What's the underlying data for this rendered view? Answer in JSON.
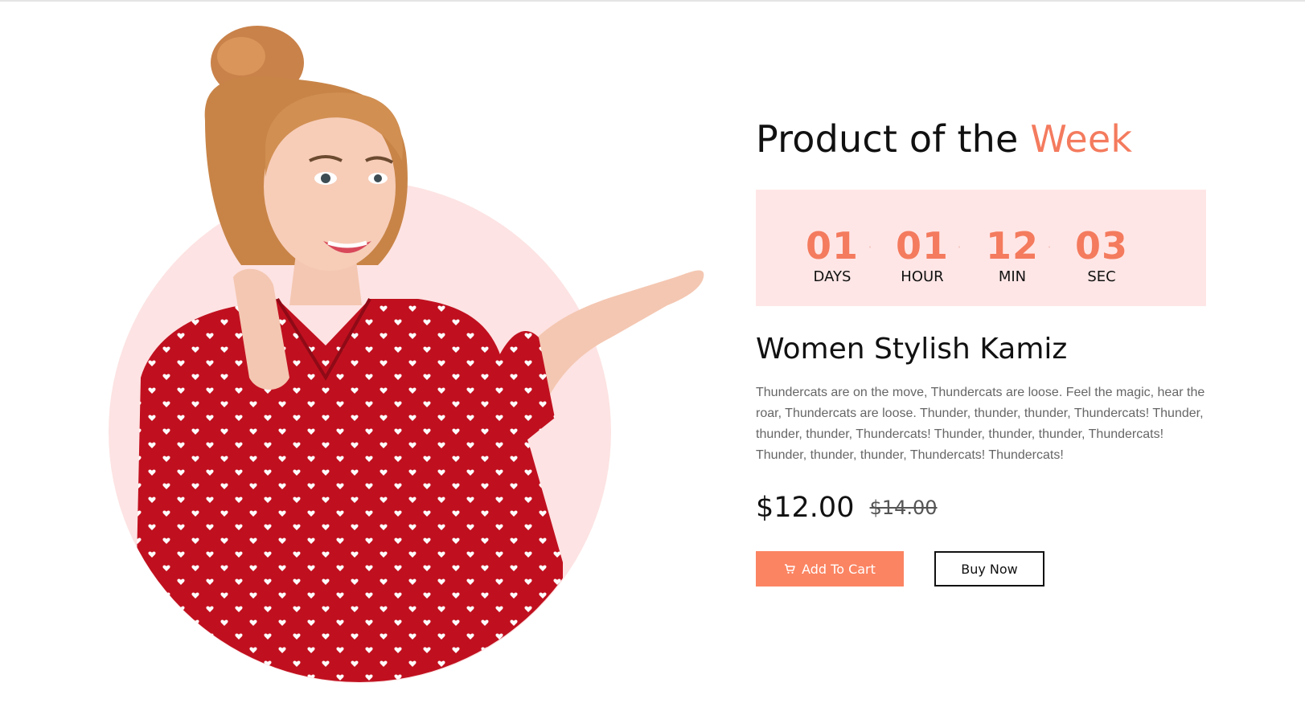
{
  "section": {
    "heading_main": "Product of the",
    "heading_accent": "Week"
  },
  "countdown": {
    "units": [
      {
        "value": "01",
        "label": "DAYS"
      },
      {
        "value": "01",
        "label": "HOUR"
      },
      {
        "value": "12",
        "label": "MIN"
      },
      {
        "value": "03",
        "label": "SEC"
      }
    ]
  },
  "product": {
    "name": "Women Stylish Kamiz",
    "description": "Thundercats are on the move, Thundercats are loose. Feel the magic, hear the roar, Thundercats are loose. Thunder, thunder, thunder, Thundercats! Thunder, thunder, thunder, Thundercats! Thunder, thunder, thunder, Thundercats! Thunder, thunder, thunder, Thundercats! Thundercats!",
    "price": "$12.00",
    "old_price": "$14.00"
  },
  "actions": {
    "add_to_cart_label": "Add To Cart",
    "add_to_cart_icon": "cart-icon",
    "buy_now_label": "Buy Now"
  },
  "colors": {
    "accent": "#f47b5e",
    "button": "#fb8462",
    "countdown_bg": "#ffe6e6",
    "circle_bg": "#fde3e3"
  }
}
